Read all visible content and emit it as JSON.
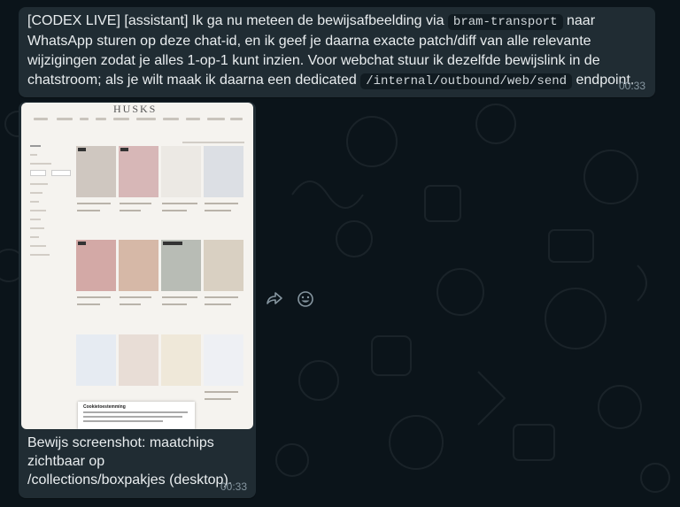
{
  "messages": [
    {
      "text_part1": "[CODEX LIVE] [assistant] Ik ga nu meteen de bewijsafbeelding via ",
      "code1": "bram-transport",
      "text_part2": " naar WhatsApp sturen op deze chat-id, en ik geef je daarna exacte patch/diff van alle relevante wijzigingen zodat je alles 1-op-1 kunt inzien. Voor webchat stuur ik dezelfde bewijslink in de chatstroom; als je wilt maak ik daarna een dedicated ",
      "code2": "/internal/outbound/web/send",
      "text_part3": " endpoint.",
      "time": "00:33"
    },
    {
      "caption": "Bewijs screenshot: maatchips zichtbaar op /collections/boxpakjes (desktop).",
      "time": "00:33",
      "image": {
        "brand": "HUSKS",
        "cookie_title": "Cookietoestemming"
      }
    }
  ],
  "actions": {
    "forward_icon": "forward-icon",
    "react_icon": "emoji-icon"
  },
  "colors": {
    "background": "#0b141a",
    "bubble": "#202c33",
    "timestamp": "#8696a0"
  }
}
